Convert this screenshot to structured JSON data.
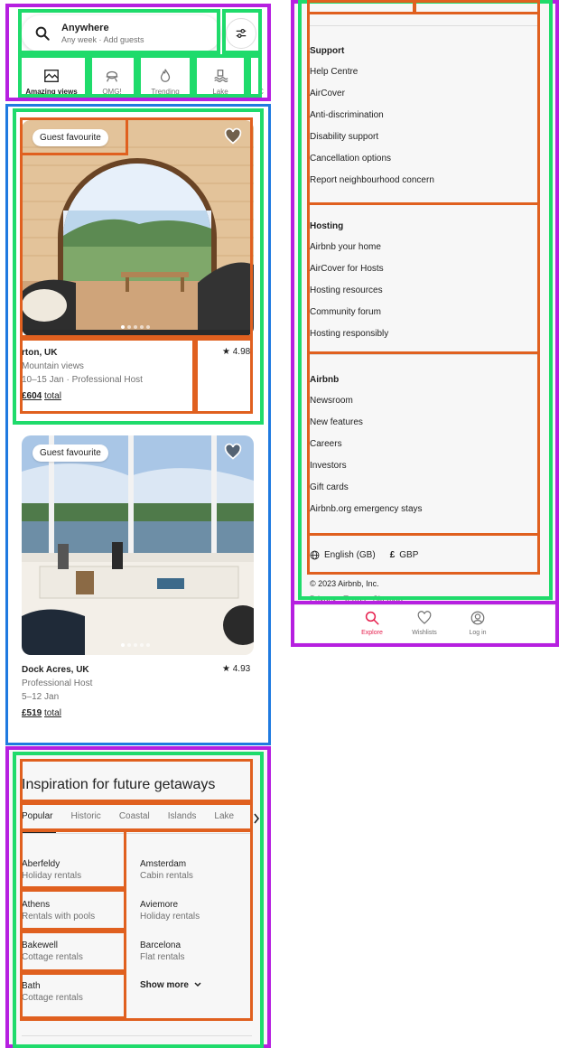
{
  "header": {
    "search_title": "Anywhere",
    "search_sub": "Any week · Add guests"
  },
  "categories": [
    {
      "label": "Amazing views",
      "icon": "amazing-views-icon",
      "active": true
    },
    {
      "label": "OMG!",
      "icon": "omg-icon"
    },
    {
      "label": "Trending",
      "icon": "trending-icon"
    },
    {
      "label": "Lake",
      "icon": "lake-icon"
    },
    {
      "label": "C",
      "icon": ""
    }
  ],
  "listings": [
    {
      "badge": "Guest favourite",
      "name": "rton, UK",
      "line1": "Mountain views",
      "line2": "10–15 Jan · Professional Host",
      "price": "£604",
      "price_suffix": "total",
      "rating": "★ 4.98"
    },
    {
      "badge": "Guest favourite",
      "name": "Dock Acres, UK",
      "line1": "Professional Host",
      "line2": "5–12 Jan",
      "price": "£519",
      "price_suffix": "total",
      "rating": "★ 4.93"
    }
  ],
  "inspiration": {
    "title": "Inspiration for future getaways",
    "tabs": [
      "Popular",
      "Historic",
      "Coastal",
      "Islands",
      "Lake"
    ],
    "destinations": [
      {
        "name": "Aberfeldy",
        "type": "Holiday rentals"
      },
      {
        "name": "Amsterdam",
        "type": "Cabin rentals"
      },
      {
        "name": "Athens",
        "type": "Rentals with pools"
      },
      {
        "name": "Aviemore",
        "type": "Holiday rentals"
      },
      {
        "name": "Bakewell",
        "type": "Cottage rentals"
      },
      {
        "name": "Barcelona",
        "type": "Flat rentals"
      },
      {
        "name": "Bath",
        "type": "Cottage rentals"
      }
    ],
    "show_more": "Show more"
  },
  "footer": {
    "support": {
      "heading": "Support",
      "links": [
        "Help Centre",
        "AirCover",
        "Anti-discrimination",
        "Disability support",
        "Cancellation options",
        "Report neighbourhood concern"
      ]
    },
    "hosting": {
      "heading": "Hosting",
      "links": [
        "Airbnb your home",
        "AirCover for Hosts",
        "Hosting resources",
        "Community forum",
        "Hosting responsibly"
      ]
    },
    "airbnb": {
      "heading": "Airbnb",
      "links": [
        "Newsroom",
        "New features",
        "Careers",
        "Investors",
        "Gift cards",
        "Airbnb.org emergency stays"
      ]
    },
    "language": "English (GB)",
    "currency_symbol": "£",
    "currency": "GBP",
    "copyright": "© 2023 Airbnb, Inc.",
    "partial_links": "Privacy · Terms · Sitemap"
  },
  "bottom_nav": [
    {
      "label": "Explore",
      "icon": "search-icon",
      "active": true
    },
    {
      "label": "Wishlists",
      "icon": "heart-icon"
    },
    {
      "label": "Log in",
      "icon": "user-icon"
    }
  ],
  "colors": {
    "accent": "#e61e4d",
    "text": "#222222",
    "muted": "#717171",
    "footer_bg": "#f7f7f7"
  }
}
